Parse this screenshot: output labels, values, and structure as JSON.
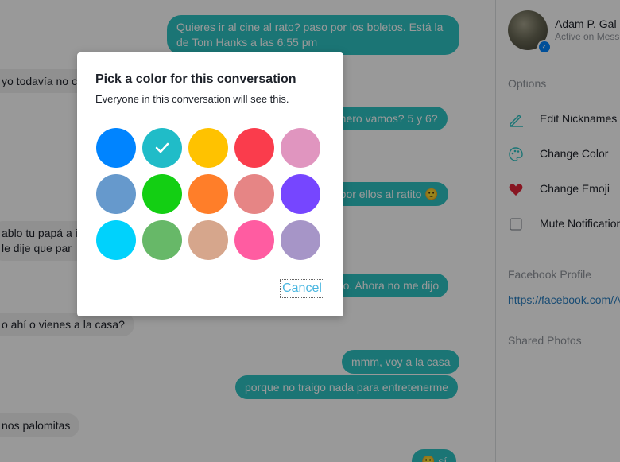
{
  "chat": {
    "messages": [
      {
        "dir": "out",
        "text_lines": [
          "Quieres ir al cine al rato? paso por los boletos. Está la",
          "de Tom Hanks a las 6:55 pm"
        ]
      },
      {
        "dir": "in",
        "text": "yo todavía no co"
      },
      {
        "dir": "out",
        "text": "úmero vamos? 5 y 6?"
      },
      {
        "dir": "out",
        "text": "o por ellos al ratito 🙂"
      },
      {
        "dir": "in",
        "text_lines": [
          "ablo tu papá a ir",
          "le dije que par"
        ]
      },
      {
        "dir": "out",
        "text": "odo. Ahora no me dijo"
      },
      {
        "dir": "in",
        "text": "o ahí o vienes a la casa?"
      },
      {
        "dir": "out",
        "text": "mmm, voy a la casa"
      },
      {
        "dir": "out",
        "text": "porque no traigo nada para entretenerme"
      },
      {
        "dir": "in",
        "text": "nos palomitas"
      },
      {
        "dir": "out",
        "text": "🙂 sí"
      }
    ]
  },
  "sidebar": {
    "name": "Adam P. Gal",
    "status": "Active on Mess",
    "options_header": "Options",
    "options": [
      {
        "label": "Edit Nicknames",
        "icon": "pencil-icon"
      },
      {
        "label": "Change Color",
        "icon": "palette-icon"
      },
      {
        "label": "Change Emoji",
        "icon": "heart-icon"
      },
      {
        "label": "Mute Notification",
        "icon": "checkbox-icon"
      }
    ],
    "profile_header": "Facebook Profile",
    "profile_link": "https://facebook.com/A",
    "photos_header": "Shared Photos"
  },
  "modal": {
    "title": "Pick a color for this conversation",
    "subtitle": "Everyone in this conversation will see this.",
    "colors": [
      "#0084ff",
      "#20bcc8",
      "#ffc200",
      "#fa3c4c",
      "#e095bf",
      "#6699cc",
      "#13cf13",
      "#ff7e29",
      "#e68585",
      "#7646ff",
      "#00d2fc",
      "#67b868",
      "#d6a68c",
      "#ff5ca1",
      "#a695c7"
    ],
    "selected_index": 1,
    "cancel_label": "Cancel"
  }
}
